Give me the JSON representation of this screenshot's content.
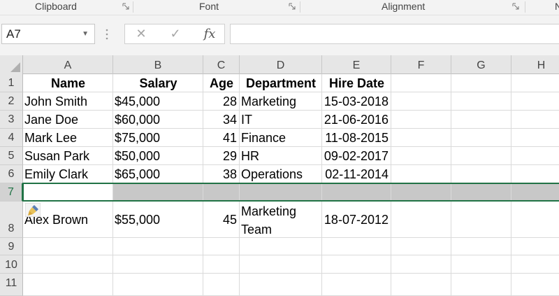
{
  "ribbon": {
    "groups": [
      {
        "label": "Clipboard"
      },
      {
        "label": "Font"
      },
      {
        "label": "Alignment"
      },
      {
        "label": "N"
      }
    ]
  },
  "formula_bar": {
    "name_box": "A7",
    "cancel_icon": "✕",
    "enter_icon": "✓",
    "fx_label": "fx",
    "formula": ""
  },
  "sheet": {
    "columns": [
      "A",
      "B",
      "C",
      "D",
      "E",
      "F",
      "G",
      "H"
    ],
    "row_numbers": [
      "1",
      "2",
      "3",
      "4",
      "5",
      "6",
      "7",
      "8",
      "9",
      "10",
      "11"
    ],
    "header": [
      "Name",
      "Salary",
      "Age",
      "Department",
      "Hire Date"
    ],
    "rows": [
      [
        "John Smith",
        "$45,000",
        "28",
        "Marketing",
        "15-03-2018"
      ],
      [
        "Jane Doe",
        "$60,000",
        "34",
        "IT",
        "21-06-2016"
      ],
      [
        "Mark Lee",
        "$75,000",
        "41",
        "Finance",
        "11-08-2015"
      ],
      [
        "Susan Park",
        "$50,000",
        "29",
        "HR",
        "09-02-2017"
      ],
      [
        "Emily Clark",
        "$65,000",
        "38",
        "Operations",
        "02-11-2014"
      ],
      [
        "",
        "",
        "",
        "",
        ""
      ],
      [
        "Alex Brown",
        "$55,000",
        "45",
        "Marketing Team",
        "18-07-2012"
      ]
    ],
    "active_cell": "A7",
    "selected_row": "7"
  },
  "colors": {
    "accent": "#217346",
    "selection": "#c8c8c8"
  },
  "icons": {
    "paste_options": "paste-brush-icon"
  }
}
